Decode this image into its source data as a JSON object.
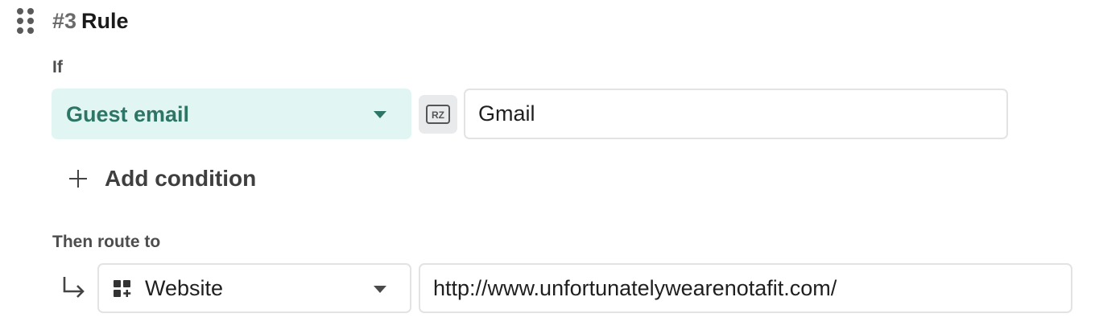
{
  "rule": {
    "number": "#3",
    "title": "Rule"
  },
  "condition": {
    "if_label": "If",
    "field": "Guest email",
    "operator_icon": "regex-icon",
    "value": "Gmail",
    "add_condition_label": "Add condition"
  },
  "route": {
    "then_label": "Then route to",
    "type": "Website",
    "type_icon": "grid-plus-icon",
    "url": "http://www.unfortunatelywearenotafit.com/"
  },
  "colors": {
    "field_background": "#e1f6f2",
    "field_text": "#2d7566",
    "border": "#e3e3e3"
  }
}
